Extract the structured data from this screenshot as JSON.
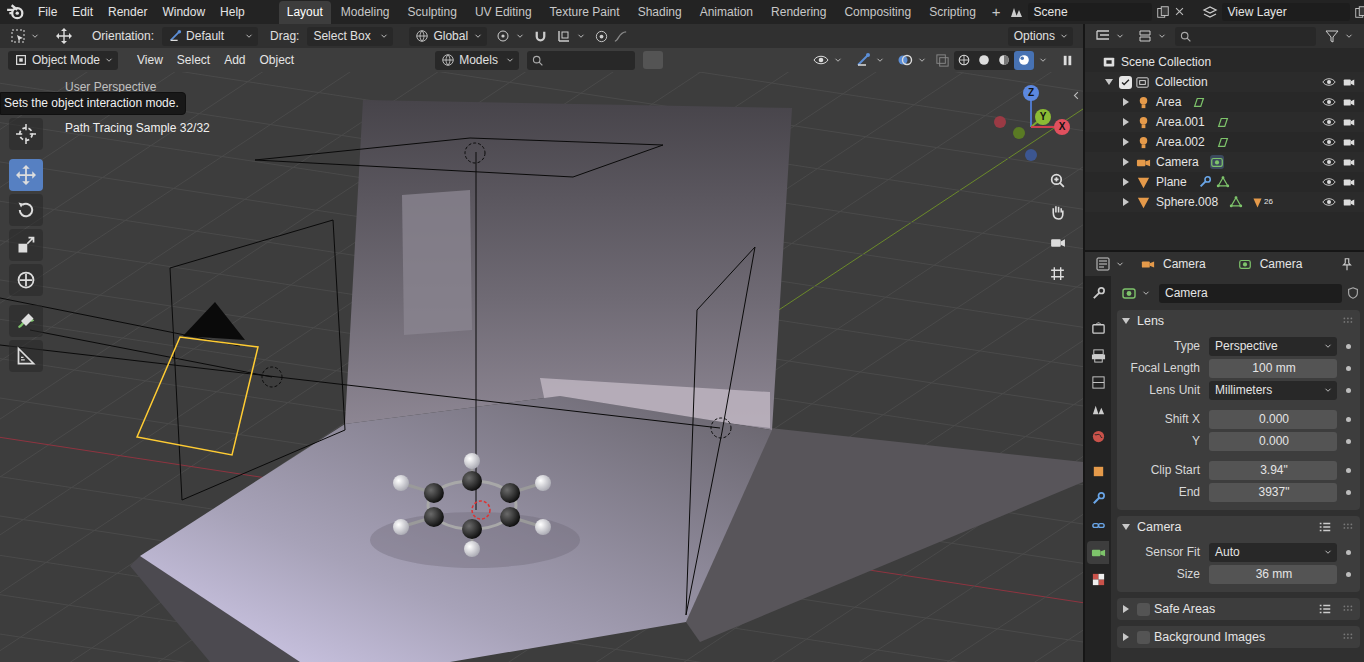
{
  "topbar": {
    "menus": [
      "File",
      "Edit",
      "Render",
      "Window",
      "Help"
    ],
    "workspaces": [
      {
        "label": "Layout",
        "selected": true
      },
      {
        "label": "Modeling",
        "selected": false
      },
      {
        "label": "Sculpting",
        "selected": false
      },
      {
        "label": "UV Editing",
        "selected": false
      },
      {
        "label": "Texture Paint",
        "selected": false
      },
      {
        "label": "Shading",
        "selected": false
      },
      {
        "label": "Animation",
        "selected": false
      },
      {
        "label": "Rendering",
        "selected": false
      },
      {
        "label": "Compositing",
        "selected": false
      },
      {
        "label": "Scripting",
        "selected": false
      }
    ],
    "add_workspace": "+",
    "scene": "Scene",
    "view_layer": "View Layer"
  },
  "tool_header": {
    "orientation_label": "Orientation:",
    "orientation": "Default",
    "drag_label": "Drag:",
    "drag": "Select Box",
    "transform_orientation": "Global",
    "options": "Options"
  },
  "viewport_header": {
    "mode": "Object Mode",
    "menus": [
      "View",
      "Select",
      "Add",
      "Object"
    ],
    "collection": "Models",
    "shading": [
      {
        "selected": false
      },
      {
        "selected": false
      },
      {
        "selected": false
      },
      {
        "selected": true
      }
    ]
  },
  "viewport": {
    "view_name": "User Perspective",
    "render_status": "Path Tracing Sample 32/32",
    "tooltip": "Sets the object interaction mode.",
    "toolbar": [
      {
        "selected": false
      },
      {
        "selected": true
      },
      {
        "selected": false
      },
      {
        "selected": false
      },
      {
        "selected": false
      },
      {
        "selected": false
      },
      {
        "selected": false
      }
    ],
    "gizmo": {
      "x": "X",
      "y": "Y",
      "z": "Z"
    }
  },
  "outliner": {
    "root": "Scene Collection",
    "collection": {
      "label": "Collection",
      "checked": true,
      "expanded": true,
      "visible": true,
      "renderable": true
    },
    "items": [
      {
        "label": "Area",
        "kind": "light",
        "expanded": false,
        "modifier": false,
        "visible": true,
        "renderable": true
      },
      {
        "label": "Area.001",
        "kind": "light",
        "expanded": false,
        "modifier": false,
        "visible": true,
        "renderable": true
      },
      {
        "label": "Area.002",
        "kind": "light",
        "expanded": false,
        "modifier": false,
        "visible": true,
        "renderable": true
      },
      {
        "label": "Camera",
        "kind": "camera",
        "expanded": false,
        "modifier": false,
        "visible": true,
        "renderable": true
      },
      {
        "label": "Plane",
        "kind": "mesh",
        "expanded": false,
        "modifier": true,
        "visible": true,
        "renderable": true
      },
      {
        "label": "Sphere.008",
        "kind": "mesh",
        "expanded": false,
        "modifier": false,
        "badge": "26",
        "visible": true,
        "renderable": true
      }
    ]
  },
  "properties": {
    "breadcrumb": [
      "Camera",
      "Camera"
    ],
    "datablock": "Camera",
    "tabs": [
      {
        "selected": false
      },
      {
        "selected": false
      },
      {
        "selected": false
      },
      {
        "selected": false
      },
      {
        "selected": false
      },
      {
        "selected": false
      },
      {
        "selected": false
      },
      {
        "selected": false
      },
      {
        "selected": false
      },
      {
        "selected": true
      },
      {
        "selected": false
      }
    ],
    "panels": [
      {
        "title": "Lens",
        "expanded": true,
        "presets": false,
        "groups": [
          [
            {
              "label": "Type",
              "value": "Perspective",
              "kind": "dropdown"
            },
            {
              "label": "Focal Length",
              "value": "100 mm",
              "kind": "number"
            },
            {
              "label": "Lens Unit",
              "value": "Millimeters",
              "kind": "dropdown"
            }
          ],
          [
            {
              "label": "Shift X",
              "value": "0.000",
              "kind": "number"
            },
            {
              "label": "Y",
              "value": "0.000",
              "kind": "number"
            }
          ],
          [
            {
              "label": "Clip Start",
              "value": "3.94\"",
              "kind": "number"
            },
            {
              "label": "End",
              "value": "3937\"",
              "kind": "number"
            }
          ]
        ]
      },
      {
        "title": "Camera",
        "expanded": true,
        "presets": true,
        "groups": [
          [
            {
              "label": "Sensor Fit",
              "value": "Auto",
              "kind": "dropdown"
            },
            {
              "label": "Size",
              "value": "36 mm",
              "kind": "number"
            }
          ]
        ]
      },
      {
        "title": "Safe Areas",
        "expanded": false,
        "checked": false,
        "presets": true,
        "groups": []
      },
      {
        "title": "Background Images",
        "expanded": false,
        "checked": false,
        "presets": false,
        "groups": []
      }
    ]
  }
}
